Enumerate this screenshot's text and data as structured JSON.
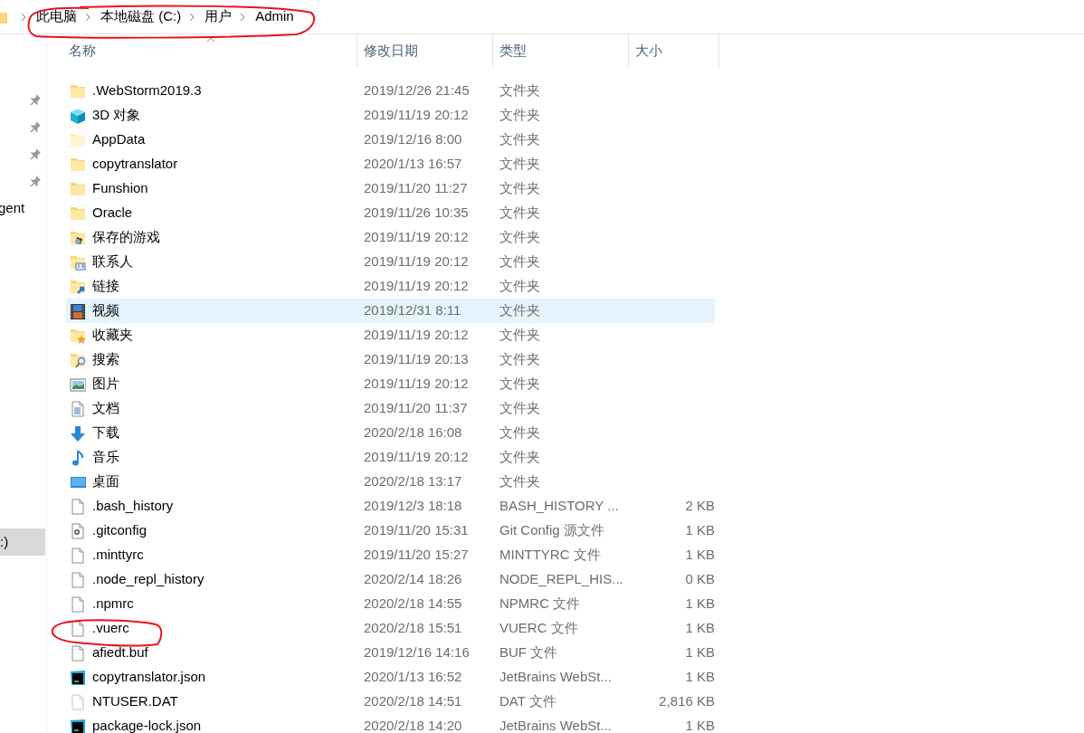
{
  "breadcrumb": [
    "此电脑",
    "本地磁盘 (C:)",
    "用户",
    "Admin"
  ],
  "nav_pane": {
    "quick_access": [
      {
        "pinned": true
      },
      {
        "pinned": true
      },
      {
        "pinned": true
      },
      {
        "pinned": true
      },
      {
        "label": "gent",
        "pinned": false
      }
    ],
    "drives": [
      {
        "label": ":)",
        "selected": true
      }
    ]
  },
  "columns": [
    "名称",
    "修改日期",
    "类型",
    "大小"
  ],
  "rows": [
    {
      "kind": "folder",
      "name": ".WebStorm2019.3",
      "date": "2019/12/26 21:45",
      "type": "文件夹",
      "selected": false
    },
    {
      "kind": "cube",
      "name": "3D 对象",
      "date": "2019/11/19 20:12",
      "type": "文件夹",
      "selected": false
    },
    {
      "kind": "hidden-folder",
      "name": "AppData",
      "date": "2019/12/16 8:00",
      "type": "文件夹",
      "selected": false
    },
    {
      "kind": "folder",
      "name": "copytranslator",
      "date": "2020/1/13 16:57",
      "type": "文件夹",
      "selected": false
    },
    {
      "kind": "folder",
      "name": "Funshion",
      "date": "2019/11/20 11:27",
      "type": "文件夹",
      "selected": false
    },
    {
      "kind": "folder",
      "name": "Oracle",
      "date": "2019/11/26 10:35",
      "type": "文件夹",
      "selected": false
    },
    {
      "kind": "games",
      "name": "保存的游戏",
      "date": "2019/11/19 20:12",
      "type": "文件夹",
      "selected": false
    },
    {
      "kind": "contacts",
      "name": "联系人",
      "date": "2019/11/19 20:12",
      "type": "文件夹",
      "selected": false
    },
    {
      "kind": "links",
      "name": "链接",
      "date": "2019/11/19 20:12",
      "type": "文件夹",
      "selected": false
    },
    {
      "kind": "video",
      "name": "视频",
      "date": "2019/12/31 8:11",
      "type": "文件夹",
      "selected": true
    },
    {
      "kind": "favorites",
      "name": "收藏夹",
      "date": "2019/11/19 20:12",
      "type": "文件夹",
      "selected": false
    },
    {
      "kind": "search",
      "name": "搜索",
      "date": "2019/11/19 20:13",
      "type": "文件夹",
      "selected": false
    },
    {
      "kind": "pictures",
      "name": "图片",
      "date": "2019/11/19 20:12",
      "type": "文件夹",
      "selected": false
    },
    {
      "kind": "documents",
      "name": "文档",
      "date": "2019/11/20 11:37",
      "type": "文件夹",
      "selected": false
    },
    {
      "kind": "downloads",
      "name": "下载",
      "date": "2020/2/18 16:08",
      "type": "文件夹",
      "selected": false
    },
    {
      "kind": "music",
      "name": "音乐",
      "date": "2019/11/19 20:12",
      "type": "文件夹",
      "selected": false
    },
    {
      "kind": "desktop",
      "name": "桌面",
      "date": "2020/2/18 13:17",
      "type": "文件夹",
      "selected": false
    },
    {
      "kind": "file",
      "name": ".bash_history",
      "date": "2019/12/3 18:18",
      "type": "BASH_HISTORY ...",
      "size": "2 KB",
      "selected": false
    },
    {
      "kind": "config-file",
      "name": ".gitconfig",
      "date": "2019/11/20 15:31",
      "type": "Git Config 源文件",
      "size": "1 KB",
      "selected": false
    },
    {
      "kind": "file",
      "name": ".minttyrc",
      "date": "2019/11/20 15:27",
      "type": "MINTTYRC 文件",
      "size": "1 KB",
      "selected": false
    },
    {
      "kind": "file",
      "name": ".node_repl_history",
      "date": "2020/2/14 18:26",
      "type": "NODE_REPL_HIS...",
      "size": "0 KB",
      "selected": false
    },
    {
      "kind": "file",
      "name": ".npmrc",
      "date": "2020/2/18 14:55",
      "type": "NPMRC 文件",
      "size": "1 KB",
      "selected": false
    },
    {
      "kind": "file",
      "name": ".vuerc",
      "date": "2020/2/18 15:51",
      "type": "VUERC 文件",
      "size": "1 KB",
      "selected": false
    },
    {
      "kind": "file",
      "name": "afiedt.buf",
      "date": "2019/12/16 14:16",
      "type": "BUF 文件",
      "size": "1 KB",
      "selected": false
    },
    {
      "kind": "webstorm-file",
      "name": "copytranslator.json",
      "date": "2020/1/13 16:52",
      "type": "JetBrains WebSt...",
      "size": "1 KB",
      "selected": false
    },
    {
      "kind": "hidden-file",
      "name": "NTUSER.DAT",
      "date": "2020/2/18 14:51",
      "type": "DAT 文件",
      "size": "2,816 KB",
      "selected": false
    },
    {
      "kind": "webstorm-file",
      "name": "package-lock.json",
      "date": "2020/2/18 14:20",
      "type": "JetBrains WebSt...",
      "size": "1 KB",
      "selected": false
    }
  ]
}
